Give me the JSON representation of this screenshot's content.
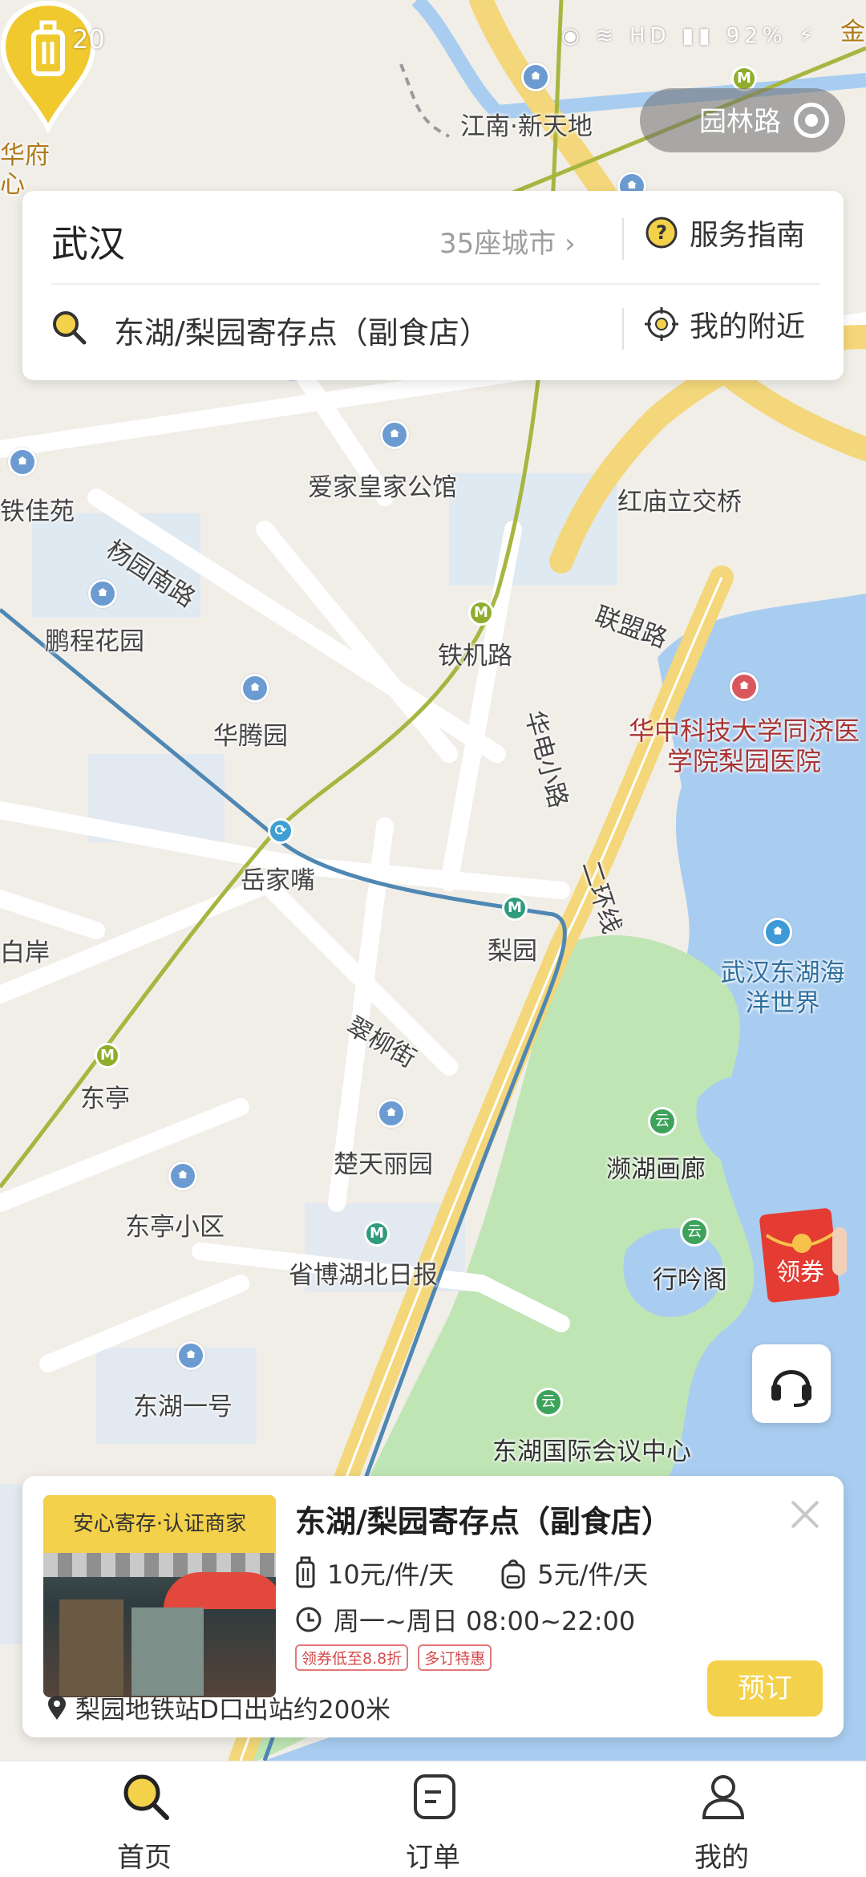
{
  "status_bar": {
    "time": "20",
    "battery": "92%"
  },
  "map": {
    "route_pill_label": "园林路",
    "labels": {
      "jiangnan": "江南·新天地",
      "huafu": "华府",
      "huafu2": "心",
      "aijia": "爱家皇家公馆",
      "hongmiao": "红庙立交桥",
      "tiejiayuan": "铁佳苑",
      "yangyuan": "杨园南路",
      "pengcheng": "鹏程花园",
      "tiejilu": "铁机路",
      "lianmeng": "联盟路",
      "huatengyuan": "华腾园",
      "huadian": "华电小路",
      "hospital": "华中科技大学同济医学院梨园医院",
      "yuejiazui": "岳家嘴",
      "liyuan": "梨园",
      "erhuan": "二环线",
      "baian": "白岸",
      "ocean": "武汉东湖海洋世界",
      "cuiliu": "翠柳街",
      "dongting": "东亭",
      "chutian": "楚天丽园",
      "binhu": "濒湖画廊",
      "dongtingxq": "东亭小区",
      "shengbo": "省博湖北日报",
      "xingyin": "行吟阁",
      "donghu1": "东湖一号",
      "donghuconf": "东湖国际会议中心",
      "jin": "金"
    }
  },
  "search_card": {
    "city": "武汉",
    "city_count": "35座城市",
    "service_guide": "服务指南",
    "search_text": "东湖/梨园寄存点（副食店）",
    "nearby": "我的附近"
  },
  "coupon": {
    "label": "领券"
  },
  "store": {
    "badge": "安心寄存·认证商家",
    "name": "东湖/梨园寄存点（副食店）",
    "price_luggage": "10元/件/天",
    "price_bag": "5元/件/天",
    "hours": "周一~周日 08:00~22:00",
    "tags": [
      "领券低至8.8折",
      "多订特惠"
    ],
    "address": "梨园地铁站D口出站约200米",
    "book_label": "预订"
  },
  "nav": {
    "home": "首页",
    "orders": "订单",
    "mine": "我的"
  },
  "colors": {
    "accent": "#f3d14a",
    "water": "#a9cdf0",
    "park": "#bfe5b4"
  }
}
